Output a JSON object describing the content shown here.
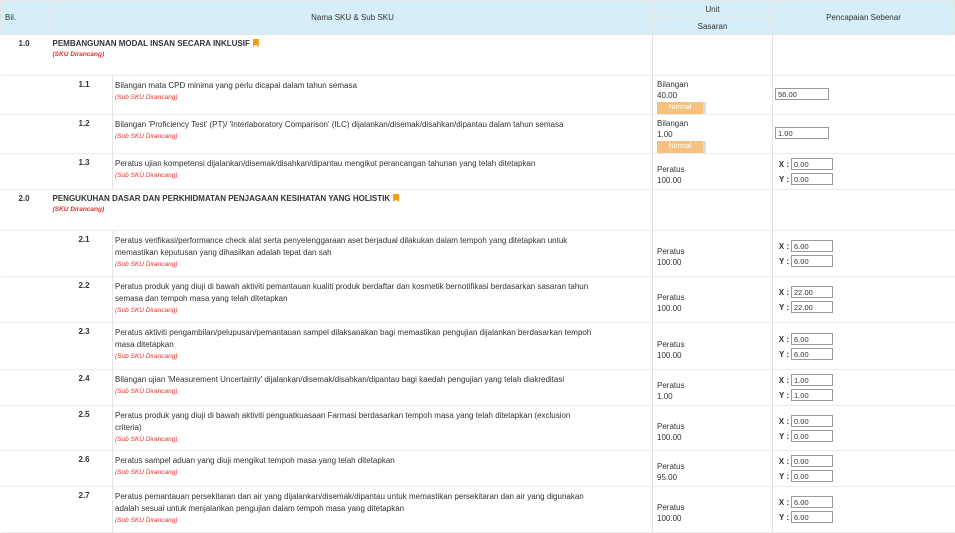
{
  "headers": {
    "bil": "Bil.",
    "name": "Nama SKU & Sub SKU",
    "unit": "Unit",
    "sasaran": "Sasaran",
    "pencapaian": "Pencapaian Sebenar"
  },
  "sections": [
    {
      "num": "1.0",
      "title": "PEMBANGUNAN MODAL INSAN SECARA INKLUSIF",
      "tag": "(SKU Dirancang)",
      "items": [
        {
          "num": "1.1",
          "desc": "Bilangan mata CPD minima yang perlu dicapai dalam tahun semasa",
          "tag": "(Sub SKU Dirancang)",
          "unit": "Bilangan",
          "target": "40.00",
          "badge": "Normal",
          "value": "56.00"
        },
        {
          "num": "1.2",
          "desc": "Bilangan 'Proficiency Test' (PT)/ 'Interlaboratory Comparison' (ILC) dijalankan/disemak/disahkan/dipantau dalam tahun semasa",
          "tag": "(Sub SKU Dirancang)",
          "unit": "Bilangan",
          "target": "1.00",
          "badge": "Normal",
          "value": "1.00"
        },
        {
          "num": "1.3",
          "desc": "Peratus ujian kompetensi dijalankan/disemak/disahkan/dipantau mengikut perancangan tahunan yang telah ditetapkan",
          "tag": "(Sub SKU Dirancang)",
          "unit": "Peratus",
          "target": "100.00",
          "x": "0.00",
          "y": "0.00"
        }
      ]
    },
    {
      "num": "2.0",
      "title": "PENGUKUHAN DASAR DAN PERKHIDMATAN PENJAGAAN KESIHATAN YANG HOLISTIK",
      "tag": "(SKU Dirancang)",
      "items": [
        {
          "num": "2.1",
          "desc": "Peratus verifikasi/performance check alat serta penyelenggaraan aset berjadual dilakukan dalam tempoh yang ditetapkan untuk memastikan keputusan yang dihasilkan adalah tepat dan sah",
          "tag": "(Sub SKU Dirancang)",
          "unit": "Peratus",
          "target": "100.00",
          "x": "6.00",
          "y": "6.00"
        },
        {
          "num": "2.2",
          "desc": "Peratus produk yang diuji di bawah aktiviti pemantauan kualiti produk berdaftar dan kosmetik bernotifikasi berdasarkan sasaran tahun semasa dan tempoh masa yang telah ditetapkan",
          "tag": "(Sub SKU Dirancang)",
          "unit": "Peratus",
          "target": "100.00",
          "x": "22.00",
          "y": "22.00"
        },
        {
          "num": "2.3",
          "desc": "Peratus aktiviti pengambilan/pelupusan/pemantauan sampel dilaksanakan bagi memastikan pengujian dijalankan berdasarkan tempoh masa ditetapkan",
          "tag": "(Sub SKU Dirancang)",
          "unit": "Peratus",
          "target": "100.00",
          "x": "6.00",
          "y": "6.00"
        },
        {
          "num": "2.4",
          "desc": "Bilangan ujian 'Measurement Uncertainty' dijalankan/disemak/disahkan/dipantau bagi kaedah pengujian yang telah diakreditasi",
          "tag": "(Sub SKU Dirancang)",
          "unit": "Peratus",
          "target": "1.00",
          "x": "1.00",
          "y": "1.00"
        },
        {
          "num": "2.5",
          "desc": "Peratus produk yang diuji di bawah aktiviti penguatkuasaan Farmasi berdasarkan tempoh masa yang telah ditetapkan (exclusion criteria)",
          "tag": "(Sub SKU Dirancang)",
          "unit": "Peratus",
          "target": "100.00",
          "x": "0.00",
          "y": "0.00"
        },
        {
          "num": "2.6",
          "desc": "Peratus sampel aduan yang diuji mengikut tempoh masa yang telah ditetapkan",
          "tag": "(Sub SKU Dirancang)",
          "unit": "Peratus",
          "target": "95.00",
          "x": "0.00",
          "y": "0.00"
        },
        {
          "num": "2.7",
          "desc": "Peratus pemantauan persekitaran dan air yang dijalankan/disemak/dipantau untuk memastikan persekitaran dan air yang digunakan adalah sesuai untuk menjalankan pengujian dalam tempoh masa yang ditetapkan",
          "tag": "(Sub SKU Dirancang)",
          "unit": "Peratus",
          "target": "100.00",
          "x": "6.00",
          "y": "6.00"
        }
      ]
    }
  ],
  "labels": {
    "x": "X :",
    "y": "Y :"
  },
  "colors": {
    "header_bg": "#d6eef8",
    "badge_bg": "#f6c07f",
    "tag_red": "#e0322a",
    "bookmark": "#f39c12"
  }
}
